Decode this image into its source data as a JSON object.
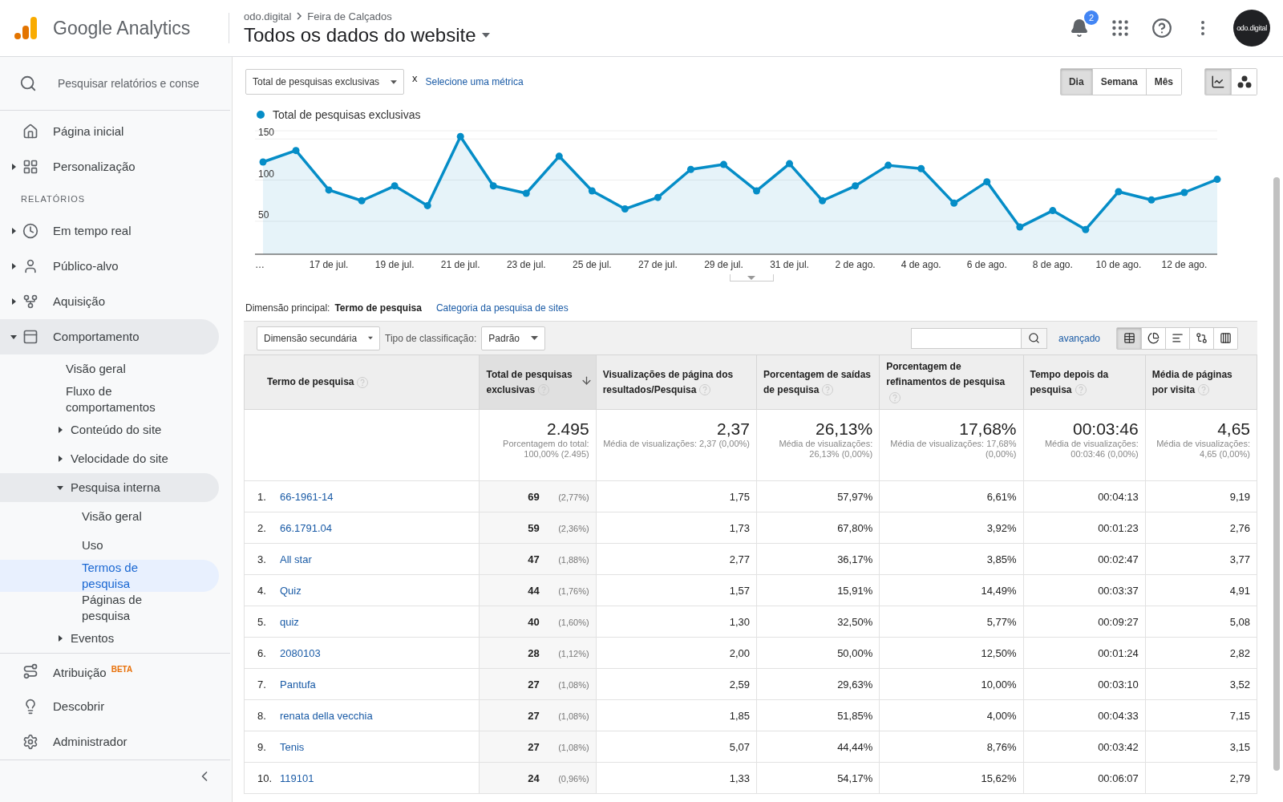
{
  "header": {
    "product": "Google Analytics",
    "breadcrumb": [
      "odo.digital",
      "Feira de Calçados"
    ],
    "view_title": "Todos os dados do website",
    "notifications": "2",
    "avatar_text": "odo.digital"
  },
  "sidebar": {
    "search_placeholder": "Pesquisar relatórios e conse",
    "top_items": [
      {
        "label": "Página inicial"
      },
      {
        "label": "Personalização",
        "expanded": false
      }
    ],
    "section_label": "RELATÓRIOS",
    "report_items": [
      {
        "label": "Em tempo real",
        "expanded": false
      },
      {
        "label": "Público-alvo",
        "expanded": false
      },
      {
        "label": "Aquisição",
        "expanded": false
      },
      {
        "label": "Comportamento",
        "expanded": true,
        "children": [
          {
            "label": "Visão geral",
            "selected": false
          },
          {
            "label": "Fluxo de comportamentos",
            "selected": false
          },
          {
            "label": "Conteúdo do site",
            "expanded": false,
            "selected": false
          },
          {
            "label": "Velocidade do site",
            "expanded": false,
            "selected": false
          },
          {
            "label": "Pesquisa interna",
            "expanded": true,
            "selected": false,
            "children": [
              {
                "label": "Visão geral",
                "selected": false
              },
              {
                "label": "Uso",
                "selected": false
              },
              {
                "label": "Termos de pesquisa",
                "selected": true
              },
              {
                "label": "Páginas de pesquisa",
                "selected": false
              }
            ]
          },
          {
            "label": "Eventos",
            "expanded": false,
            "selected": false
          }
        ]
      }
    ],
    "bottom_items": [
      {
        "label": "Atribuição",
        "badge": "BETA"
      },
      {
        "label": "Descobrir"
      },
      {
        "label": "Administrador"
      }
    ]
  },
  "chart_toolbar": {
    "metric": "Total de pesquisas exclusivas",
    "remove": "x",
    "add_metric": "Selecione uma métrica",
    "periods": [
      {
        "label": "Dia",
        "selected": true
      },
      {
        "label": "Semana",
        "selected": false
      },
      {
        "label": "Mês",
        "selected": false
      }
    ],
    "chart_types": [
      {
        "kind": "line",
        "selected": true
      },
      {
        "kind": "motion",
        "selected": false
      }
    ]
  },
  "chart": {
    "chart_data": {
      "type": "area",
      "categories": [
        "…",
        null,
        "17 de jul.",
        null,
        "19 de jul.",
        null,
        "21 de jul.",
        null,
        "23 de jul.",
        null,
        "25 de jul.",
        null,
        "27 de jul.",
        null,
        "29 de jul.",
        null,
        "31 de jul.",
        null,
        "2 de ago.",
        null,
        "4 de ago.",
        null,
        "6 de ago.",
        null,
        "8 de ago.",
        null,
        "10 de ago.",
        null,
        "12 de ago.",
        null
      ],
      "series": [
        {
          "name": "Total de pesquisas exclusivas",
          "color": "#058dc7",
          "values": [
            122,
            136,
            88,
            75,
            93,
            69,
            153,
            93,
            84,
            129,
            87,
            65,
            79,
            113,
            119,
            87,
            120,
            75,
            93,
            118,
            114,
            72,
            98,
            43,
            63,
            40,
            86,
            76,
            85,
            101
          ]
        }
      ],
      "ylim": [
        10,
        160
      ],
      "yticks": [
        50,
        100,
        150
      ],
      "grid": true
    }
  },
  "dimension": {
    "label": "Dimensão principal:",
    "options": [
      {
        "label": "Termo de pesquisa",
        "selected": true
      },
      {
        "label": "Categoria da pesquisa de sites",
        "selected": false
      }
    ]
  },
  "table_controls": {
    "secondary_dimension": "Dimensão secundária",
    "sort_label": "Tipo de classificação:",
    "sort_value": "Padrão",
    "advanced": "avançado",
    "views": [
      {
        "kind": "table",
        "selected": true
      },
      {
        "kind": "pie",
        "selected": false
      },
      {
        "kind": "bars",
        "selected": false
      },
      {
        "kind": "comparison",
        "selected": false
      },
      {
        "kind": "pivot",
        "selected": false
      }
    ]
  },
  "table": {
    "columns": [
      {
        "label": "Termo de pesquisa",
        "sorted": false
      },
      {
        "label": "Total de pesquisas exclusivas",
        "sorted": true
      },
      {
        "label": "Visualizações de página dos resultados/Pesquisa",
        "sorted": false
      },
      {
        "label": "Porcentagem de saídas de pesquisa",
        "sorted": false
      },
      {
        "label": "Porcentagem de refinamentos de pesquisa",
        "sorted": false
      },
      {
        "label": "Tempo depois da pesquisa",
        "sorted": false
      },
      {
        "label": "Média de páginas por visita",
        "sorted": false
      }
    ],
    "totals": [
      {
        "value": "2.495",
        "note": "Porcentagem do total: 100,00% (2.495)"
      },
      {
        "value": "2,37",
        "note": "Média de visualizações: 2,37 (0,00%)"
      },
      {
        "value": "26,13%",
        "note": "Média de visualizações: 26,13% (0,00%)"
      },
      {
        "value": "17,68%",
        "note": "Média de visualizações: 17,68% (0,00%)"
      },
      {
        "value": "00:03:46",
        "note": "Média de visualizações: 00:03:46 (0,00%)"
      },
      {
        "value": "4,65",
        "note": "Média de visualizações: 4,65 (0,00%)"
      }
    ],
    "rows": [
      {
        "index": "1.",
        "term": "66-1961-14",
        "total": "69",
        "share": "(2,77%)",
        "values": [
          "1,75",
          "57,97%",
          "6,61%",
          "00:04:13",
          "9,19"
        ]
      },
      {
        "index": "2.",
        "term": "66.1791.04",
        "total": "59",
        "share": "(2,36%)",
        "values": [
          "1,73",
          "67,80%",
          "3,92%",
          "00:01:23",
          "2,76"
        ]
      },
      {
        "index": "3.",
        "term": "All star",
        "total": "47",
        "share": "(1,88%)",
        "values": [
          "2,77",
          "36,17%",
          "3,85%",
          "00:02:47",
          "3,77"
        ]
      },
      {
        "index": "4.",
        "term": "Quiz",
        "total": "44",
        "share": "(1,76%)",
        "values": [
          "1,57",
          "15,91%",
          "14,49%",
          "00:03:37",
          "4,91"
        ]
      },
      {
        "index": "5.",
        "term": "quiz",
        "total": "40",
        "share": "(1,60%)",
        "values": [
          "1,30",
          "32,50%",
          "5,77%",
          "00:09:27",
          "5,08"
        ]
      },
      {
        "index": "6.",
        "term": "2080103",
        "total": "28",
        "share": "(1,12%)",
        "values": [
          "2,00",
          "50,00%",
          "12,50%",
          "00:01:24",
          "2,82"
        ]
      },
      {
        "index": "7.",
        "term": "Pantufa",
        "total": "27",
        "share": "(1,08%)",
        "values": [
          "2,59",
          "29,63%",
          "10,00%",
          "00:03:10",
          "3,52"
        ]
      },
      {
        "index": "8.",
        "term": "renata della vecchia",
        "total": "27",
        "share": "(1,08%)",
        "values": [
          "1,85",
          "51,85%",
          "4,00%",
          "00:04:33",
          "7,15"
        ]
      },
      {
        "index": "9.",
        "term": "Tenis",
        "total": "27",
        "share": "(1,08%)",
        "values": [
          "5,07",
          "44,44%",
          "8,76%",
          "00:03:42",
          "3,15"
        ]
      },
      {
        "index": "10.",
        "term": "119101",
        "total": "24",
        "share": "(0,96%)",
        "values": [
          "1,33",
          "54,17%",
          "15,62%",
          "00:06:07",
          "2,79"
        ]
      }
    ]
  }
}
